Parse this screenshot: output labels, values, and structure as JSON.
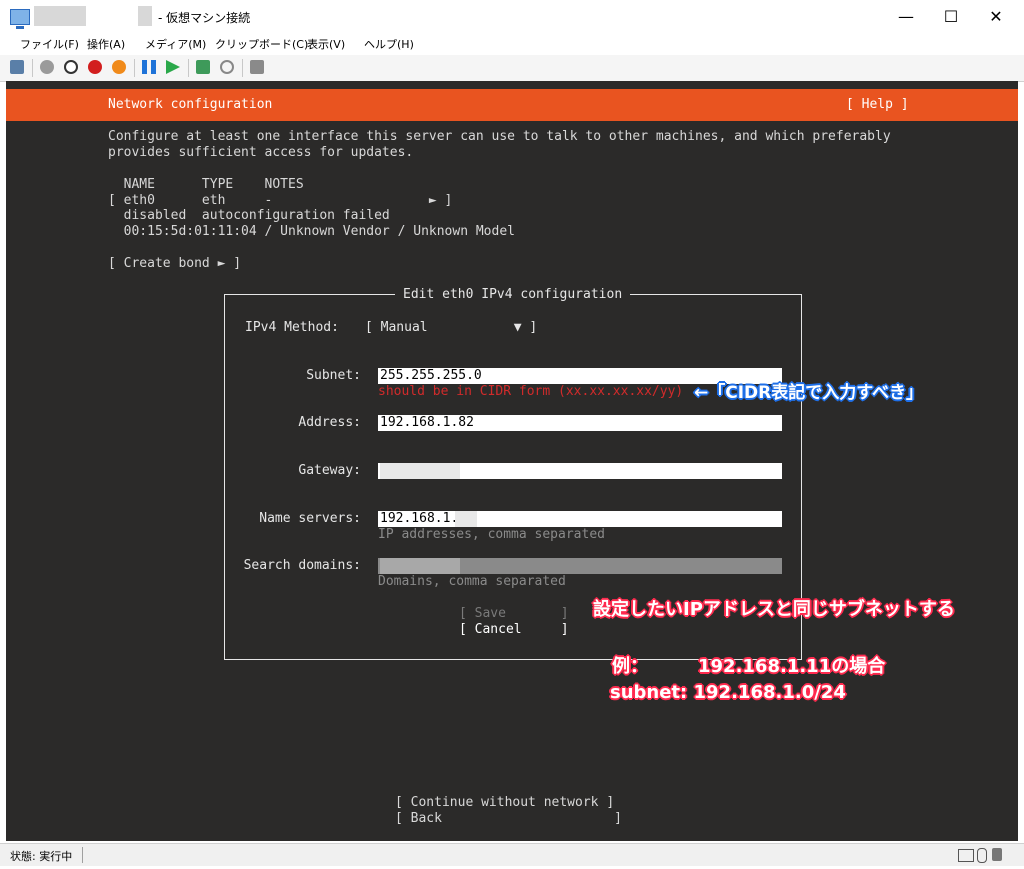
{
  "window": {
    "title": "- 仮想マシン接続",
    "minimize": "—",
    "maximize": "☐",
    "close": "✕"
  },
  "menu": [
    "ファイル(F)",
    "操作(A)",
    "メディア(M)",
    "クリップボード(C)",
    "表示(V)",
    "ヘルプ(H)"
  ],
  "console": {
    "header_title": "Network configuration",
    "header_help": "[ Help ]",
    "intro_line1": "Configure at least one interface this server can use to talk to other machines, and which preferably",
    "intro_line2": "provides sufficient access for updates.",
    "table_header": "  NAME      TYPE    NOTES",
    "row1": "[ eth0      eth     -                    ► ]",
    "row2": "  disabled  autoconfiguration failed",
    "row3": "  00:15:5d:01:11:04 / Unknown Vendor / Unknown Model",
    "create_bond": "[ Create bond ► ]",
    "continue": "[ Continue without network ]",
    "back": "[ Back                      ]"
  },
  "dialog": {
    "title": "Edit eth0 IPv4 configuration",
    "method_label": "IPv4 Method:",
    "method_value": "[ Manual           ▼ ]",
    "subnet_label": "Subnet:",
    "subnet_value": "255.255.255.0",
    "subnet_error": "should be in CIDR form (xx.xx.xx.xx/yy)",
    "address_label": "Address:",
    "address_value": "192.168.1.82",
    "gateway_label": "Gateway:",
    "nameservers_label": "Name servers:",
    "nameservers_value": "192.168.1.",
    "nameservers_hint": "IP addresses, comma separated",
    "search_label": "Search domains:",
    "search_hint": "Domains, comma separated",
    "save": "[ Save       ]",
    "cancel": "[ Cancel     ]"
  },
  "annotations": {
    "cidr_note": "←「CIDR表記で入力すべき」",
    "subnet_note": "設定したいIPアドレスと同じサブネットする",
    "example_label": "例：",
    "example_value": "192.168.1.11の場合",
    "example_subnet": "subnet: 192.168.1.0/24"
  },
  "status": {
    "text": "状態: 実行中"
  },
  "colors": {
    "header_orange": "#e95420",
    "console_bg": "#2b2a29",
    "error_red": "#d12b2b"
  }
}
